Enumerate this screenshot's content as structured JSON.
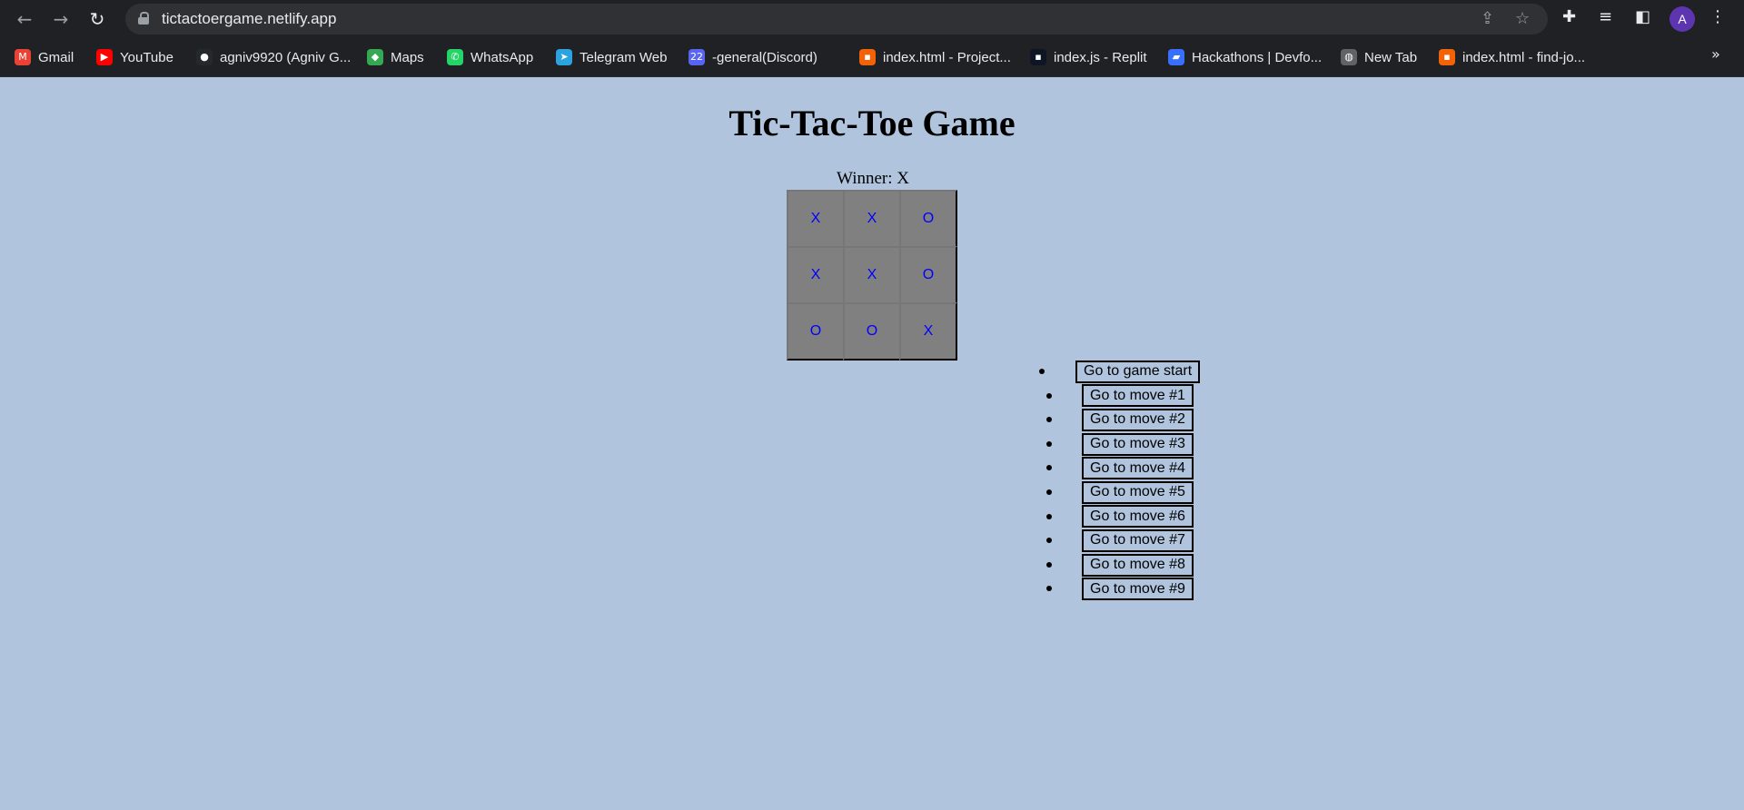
{
  "browser": {
    "url": "tictactoergame.netlify.app",
    "profile_initial": "A",
    "bookmarks": [
      {
        "label": "Gmail",
        "icon": "gmail-icon",
        "color": "#ea4335"
      },
      {
        "label": "YouTube",
        "icon": "youtube-icon",
        "color": "#ff0000"
      },
      {
        "label": "agniv9920 (Agniv G...",
        "icon": "github-icon",
        "color": "#24292e"
      },
      {
        "label": "Maps",
        "icon": "maps-icon",
        "color": "#34a853"
      },
      {
        "label": "WhatsApp",
        "icon": "whatsapp-icon",
        "color": "#25d366"
      },
      {
        "label": "Telegram Web",
        "icon": "telegram-icon",
        "color": "#2aa3df"
      },
      {
        "label": "-general(Discord)",
        "icon": "discord-icon",
        "color": "#5865f2",
        "badge": "22"
      },
      {
        "label": "index.html - Project...",
        "icon": "replit-icon",
        "color": "#f26207"
      },
      {
        "label": "index.js - Replit",
        "icon": "replit-icon",
        "color": "#0e1525"
      },
      {
        "label": "Hackathons | Devfo...",
        "icon": "devfolio-icon",
        "color": "#3770ff"
      },
      {
        "label": "New Tab",
        "icon": "globe-icon",
        "color": "#5f6368"
      },
      {
        "label": "index.html - find-jo...",
        "icon": "replit-icon",
        "color": "#f26207"
      }
    ]
  },
  "game": {
    "title": "Tic-Tac-Toe Game",
    "status": "Winner: X",
    "squares": [
      "X",
      "X",
      "O",
      "X",
      "X",
      "O",
      "O",
      "O",
      "X"
    ],
    "mark_color": "#0000ff",
    "square_color": "#808080",
    "moves": [
      "Go to game start",
      "Go to move #1",
      "Go to move #2",
      "Go to move #3",
      "Go to move #4",
      "Go to move #5",
      "Go to move #6",
      "Go to move #7",
      "Go to move #8",
      "Go to move #9"
    ]
  }
}
